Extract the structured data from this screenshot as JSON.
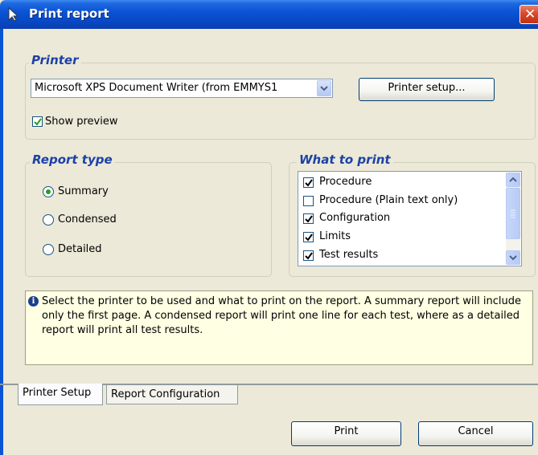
{
  "window": {
    "title": "Print report",
    "close_glyph": "✕"
  },
  "printer": {
    "legend": "Printer",
    "selected_printer": "Microsoft XPS Document Writer (from EMMYS1",
    "setup_button": "Printer setup...",
    "show_preview_label": "Show preview",
    "show_preview_checked": true
  },
  "report_type": {
    "legend": "Report type",
    "options": [
      {
        "label": "Summary",
        "selected": true
      },
      {
        "label": "Condensed",
        "selected": false
      },
      {
        "label": "Detailed",
        "selected": false
      }
    ]
  },
  "what_to_print": {
    "legend": "What to print",
    "items": [
      {
        "label": "Procedure",
        "checked": true
      },
      {
        "label": "Procedure (Plain text only)",
        "checked": false
      },
      {
        "label": "Configuration",
        "checked": true
      },
      {
        "label": "Limits",
        "checked": true
      },
      {
        "label": "Test results",
        "checked": true
      }
    ]
  },
  "info": {
    "text": "Select the printer to be used and what to print on the report. A summary report will include only the first page. A condensed report will print one line for each test, where as a detailed report will print all test results."
  },
  "tabs": [
    {
      "label": "Printer Setup",
      "active": true
    },
    {
      "label": "Report Configuration",
      "active": false
    }
  ],
  "buttons": {
    "print": "Print",
    "cancel": "Cancel"
  },
  "icons": {
    "title": "cursor-arrow-icon",
    "info": "info-icon",
    "close": "close-icon",
    "dropdown": "chevron-down-icon"
  },
  "colors": {
    "titlebar": "#0a54d6",
    "legend_text": "#1c42a8",
    "info_background": "#ffffe4",
    "dialog_background": "#ece9d8"
  }
}
